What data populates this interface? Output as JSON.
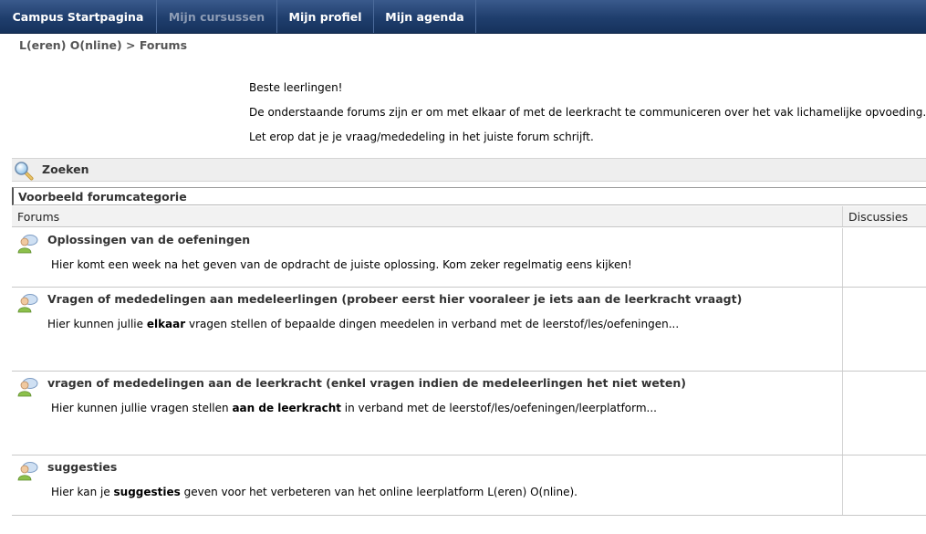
{
  "nav": {
    "items": [
      {
        "label": "Campus Startpagina",
        "disabled": false
      },
      {
        "label": "Mijn cursussen",
        "disabled": true
      },
      {
        "label": "Mijn profiel",
        "disabled": false
      },
      {
        "label": "Mijn agenda",
        "disabled": false
      }
    ]
  },
  "breadcrumb": {
    "course": "L(eren) O(nline)",
    "separator": ">",
    "current": "Forums"
  },
  "intro": {
    "line1": "Beste leerlingen!",
    "line2": "De onderstaande forums zijn er om met elkaar of met de leerkracht te communiceren over het vak lichamelijke opvoeding.",
    "line3": "Let erop dat je je vraag/mededeling in het juiste forum schrijft."
  },
  "search": {
    "label": "Zoeken",
    "icon": "magnifier-icon"
  },
  "category": {
    "title": "Voorbeeld forumcategorie"
  },
  "table": {
    "col_forums": "Forums",
    "col_discussions": "Discussies"
  },
  "forums": [
    {
      "title": "Oplossingen van de oefeningen",
      "desc_pre": "Hier komt een week na het geven van de opdracht de juiste oplossing. Kom zeker regelmatig eens kijken!",
      "desc_bold": "",
      "desc_post": ""
    },
    {
      "title": "Vragen of mededelingen aan medeleerlingen (probeer eerst hier vooraleer je iets aan de leerkracht vraagt)",
      "desc_pre": "Hier kunnen jullie ",
      "desc_bold": "elkaar",
      "desc_post": " vragen stellen of bepaalde dingen meedelen in verband met de leerstof/les/oefeningen..."
    },
    {
      "title": "vragen of mededelingen aan de leerkracht (enkel vragen indien de medeleerlingen het niet weten)",
      "desc_pre": "Hier kunnen jullie vragen stellen ",
      "desc_bold": "aan de leerkracht",
      "desc_post": " in verband met de leerstof/les/oefeningen/leerplatform..."
    },
    {
      "title": "suggesties",
      "desc_pre": "Hier kan je ",
      "desc_bold": "suggesties",
      "desc_post": " geven voor het verbeteren van het online leerplatform L(eren) O(nline)."
    }
  ],
  "colors": {
    "nav_bg": "#1f3e6d",
    "nav_disabled": "#8d9cb5",
    "title_text": "#333333"
  }
}
